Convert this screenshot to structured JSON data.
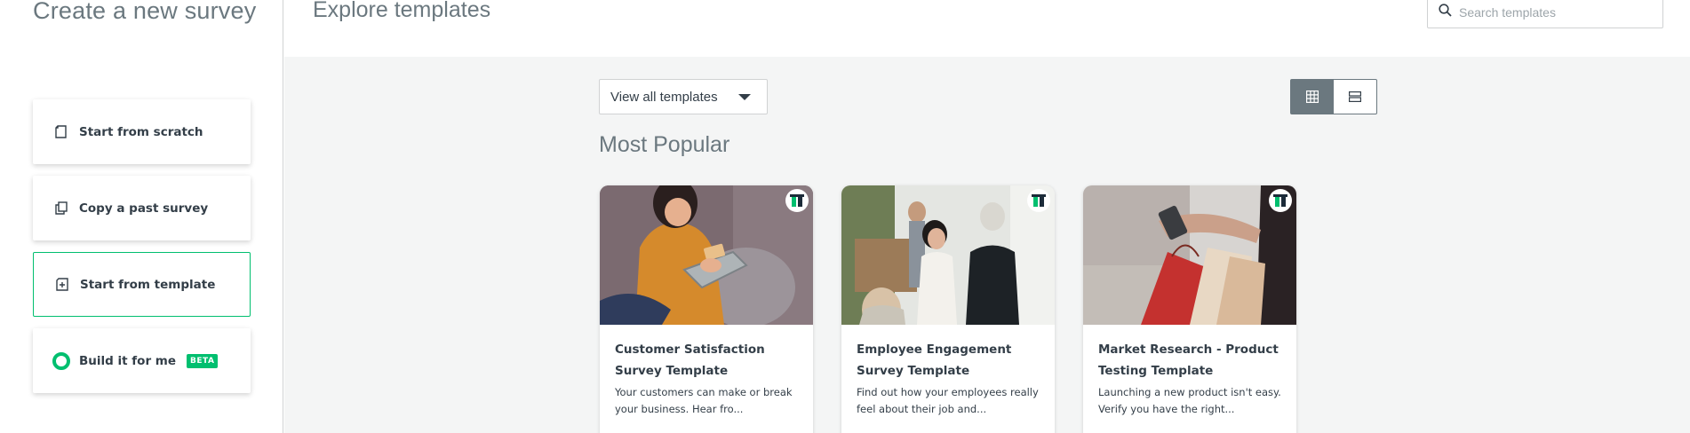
{
  "sidebar": {
    "title": "Create a new survey",
    "options": [
      {
        "label": "Start from scratch",
        "icon": "page-icon"
      },
      {
        "label": "Copy a past survey",
        "icon": "copy-icon"
      },
      {
        "label": "Start from template",
        "icon": "template-icon",
        "selected": true
      },
      {
        "label": "Build it for me",
        "icon": "ring-icon",
        "badge": "BETA"
      }
    ]
  },
  "header": {
    "title": "Explore templates",
    "search_placeholder": "Search templates"
  },
  "main": {
    "filter_value": "View all templates",
    "section_title": "Most Popular",
    "view_modes": [
      "grid-view",
      "list-view"
    ],
    "active_view": "grid-view",
    "templates": [
      {
        "title": "Customer Satisfaction Survey Template",
        "description": "Your customers can make or break your business. Hear fro..."
      },
      {
        "title": "Employee Engagement Survey Template",
        "description": "Find out how your employees really feel about their job and..."
      },
      {
        "title": "Market Research - Product Testing Template",
        "description": "Launching a new product isn't easy. Verify you have the right..."
      }
    ]
  },
  "colors": {
    "accent": "#00bf6f",
    "text": "#333e48",
    "muted": "#6b787f",
    "background": "#f4f5f5"
  }
}
